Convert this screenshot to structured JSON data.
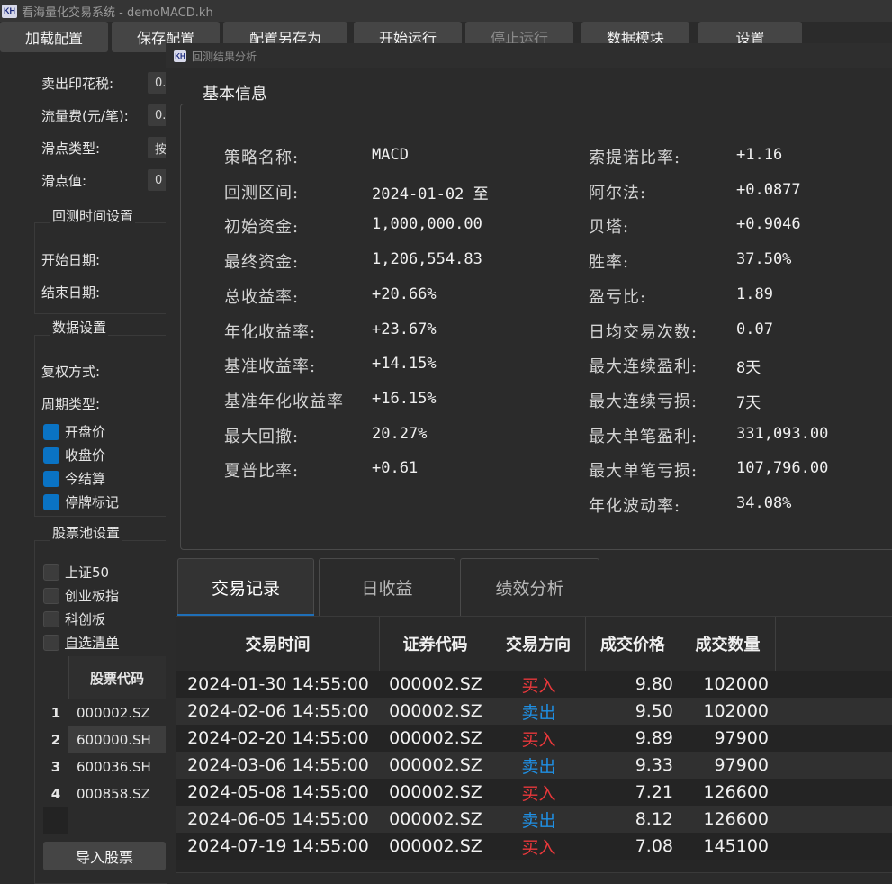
{
  "app": {
    "logo": "KH",
    "title": "看海量化交易系统 - demoMACD.kh"
  },
  "toolbar": {
    "buttons": [
      {
        "label": "加载配置",
        "enabled": true
      },
      {
        "label": "保存配置",
        "enabled": true
      },
      {
        "label": "配置另存为",
        "enabled": true
      },
      {
        "label": "开始运行",
        "enabled": true
      },
      {
        "label": "停止运行",
        "enabled": false
      },
      {
        "label": "数据模块",
        "enabled": true
      },
      {
        "label": "设置",
        "enabled": true
      }
    ]
  },
  "settings": {
    "fees": [
      {
        "label": "卖出印花税:",
        "value": "0."
      },
      {
        "label": "流量费(元/笔):",
        "value": "0."
      },
      {
        "label": "滑点类型:",
        "value": "按"
      },
      {
        "label": "滑点值:",
        "value": "0"
      }
    ],
    "backtest_time": {
      "title": "回测时间设置",
      "start_label": "开始日期:",
      "end_label": "结束日期:"
    },
    "data": {
      "title": "数据设置",
      "adjust_label": "复权方式:",
      "period_label": "周期类型:",
      "fields": [
        {
          "label": "开盘价",
          "checked": true
        },
        {
          "label": "收盘价",
          "checked": true
        },
        {
          "label": "今结算",
          "checked": true
        },
        {
          "label": "停牌标记",
          "checked": true
        }
      ]
    },
    "stock_pool": {
      "title": "股票池设置",
      "options": [
        {
          "label": "上证50",
          "checked": false
        },
        {
          "label": "创业板指",
          "checked": false
        },
        {
          "label": "科创板",
          "checked": false
        },
        {
          "label": "自选清单",
          "checked": false
        }
      ],
      "table_header": "股票代码",
      "rows": [
        {
          "index": "1",
          "code": "000002.SZ"
        },
        {
          "index": "2",
          "code": "600000.SH"
        },
        {
          "index": "3",
          "code": "600036.SH"
        },
        {
          "index": "4",
          "code": "000858.SZ"
        }
      ],
      "import_button": "导入股票"
    }
  },
  "result_window": {
    "logo": "KH",
    "title": "回测结果分析",
    "basic_info_title": "基本信息",
    "left_stats": [
      {
        "label": "策略名称:",
        "value": "MACD"
      },
      {
        "label": "回测区间:",
        "value": "2024-01-02 至"
      },
      {
        "label": "初始资金:",
        "value": "1,000,000.00"
      },
      {
        "label": "最终资金:",
        "value": "1,206,554.83"
      },
      {
        "label": "总收益率:",
        "value": "+20.66%"
      },
      {
        "label": "年化收益率:",
        "value": "+23.67%"
      },
      {
        "label": "基准收益率:",
        "value": "+14.15%"
      },
      {
        "label": "基准年化收益率",
        "value": "+16.15%"
      },
      {
        "label": "最大回撤:",
        "value": "20.27%"
      },
      {
        "label": "夏普比率:",
        "value": "+0.61"
      }
    ],
    "right_stats": [
      {
        "label": "索提诺比率:",
        "value": "+1.16"
      },
      {
        "label": "阿尔法:",
        "value": "+0.0877"
      },
      {
        "label": "贝塔:",
        "value": "+0.9046"
      },
      {
        "label": "胜率:",
        "value": "37.50%"
      },
      {
        "label": "盈亏比:",
        "value": "1.89"
      },
      {
        "label": "日均交易次数:",
        "value": "0.07"
      },
      {
        "label": "最大连续盈利:",
        "value": "8天"
      },
      {
        "label": "最大连续亏损:",
        "value": "7天"
      },
      {
        "label": "最大单笔盈利:",
        "value": "331,093.00"
      },
      {
        "label": "最大单笔亏损:",
        "value": "107,796.00"
      },
      {
        "label": "年化波动率:",
        "value": "34.08%"
      }
    ],
    "tabs": [
      {
        "label": "交易记录",
        "active": true
      },
      {
        "label": "日收益",
        "active": false
      },
      {
        "label": "绩效分析",
        "active": false
      }
    ],
    "trade_table": {
      "columns": [
        "交易时间",
        "证券代码",
        "交易方向",
        "成交价格",
        "成交数量"
      ],
      "rows": [
        {
          "time": "2024-01-30 14:55:00",
          "code": "000002.SZ",
          "side": "买入",
          "price": "9.80",
          "qty": "102000"
        },
        {
          "time": "2024-02-06 14:55:00",
          "code": "000002.SZ",
          "side": "卖出",
          "price": "9.50",
          "qty": "102000"
        },
        {
          "time": "2024-02-20 14:55:00",
          "code": "000002.SZ",
          "side": "买入",
          "price": "9.89",
          "qty": "97900"
        },
        {
          "time": "2024-03-06 14:55:00",
          "code": "000002.SZ",
          "side": "卖出",
          "price": "9.33",
          "qty": "97900"
        },
        {
          "time": "2024-05-08 14:55:00",
          "code": "000002.SZ",
          "side": "买入",
          "price": "7.21",
          "qty": "126600"
        },
        {
          "time": "2024-06-05 14:55:00",
          "code": "000002.SZ",
          "side": "卖出",
          "price": "8.12",
          "qty": "126600"
        },
        {
          "time": "2024-07-19 14:55:00",
          "code": "000002.SZ",
          "side": "买入",
          "price": "7.08",
          "qty": "145100"
        }
      ],
      "buy_label": "买入",
      "buy_color": "#e8383b",
      "sell_color": "#1f8fe3"
    }
  }
}
